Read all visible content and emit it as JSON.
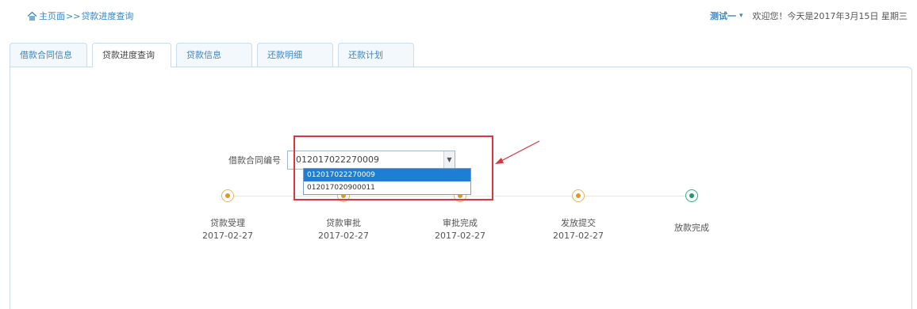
{
  "breadcrumb": {
    "home_label": "主页面",
    "separator": ">>",
    "current": "贷款进度查询"
  },
  "header": {
    "user_name": "测试一",
    "user_caret": "▾",
    "greeting": "欢迎您！今天是2017年3月15日 星期三"
  },
  "tabs": [
    {
      "label": "借款合同信息",
      "active": false
    },
    {
      "label": "贷款进度查询",
      "active": true
    },
    {
      "label": "贷款信息",
      "active": false
    },
    {
      "label": "还款明细",
      "active": false
    },
    {
      "label": "还款计划",
      "active": false
    }
  ],
  "contract": {
    "label": "借款合同编号",
    "selected_value": "012017022270009",
    "options": [
      "012017022270009",
      "012017020900011"
    ]
  },
  "steps": [
    {
      "label": "贷款受理",
      "date": "2017-02-27",
      "status": "done"
    },
    {
      "label": "贷款审批",
      "date": "2017-02-27",
      "status": "done"
    },
    {
      "label": "审批完成",
      "date": "2017-02-27",
      "status": "done"
    },
    {
      "label": "发放提交",
      "date": "2017-02-27",
      "status": "done"
    },
    {
      "label": "放款完成",
      "date": "",
      "status": "current"
    }
  ],
  "colors": {
    "accent": "#3a86c6",
    "highlight": "#d9363e",
    "step_done": "#d99a2b",
    "step_final": "#1d9a6c"
  }
}
